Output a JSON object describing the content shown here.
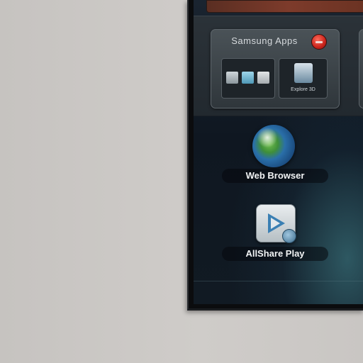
{
  "tv": {
    "panel": {
      "title": "Samsung Apps",
      "explore_label": "Explore 3D"
    },
    "apps": [
      {
        "label": "Web Browser",
        "icon": "globe-icon"
      },
      {
        "label": "AllShare Play",
        "icon": "play-icon"
      }
    ]
  },
  "colors": {
    "wall": "#c9c6c3",
    "bezel": "#0b0c0e",
    "screen_bg": "#111a23",
    "badge_red": "#c9241b"
  }
}
